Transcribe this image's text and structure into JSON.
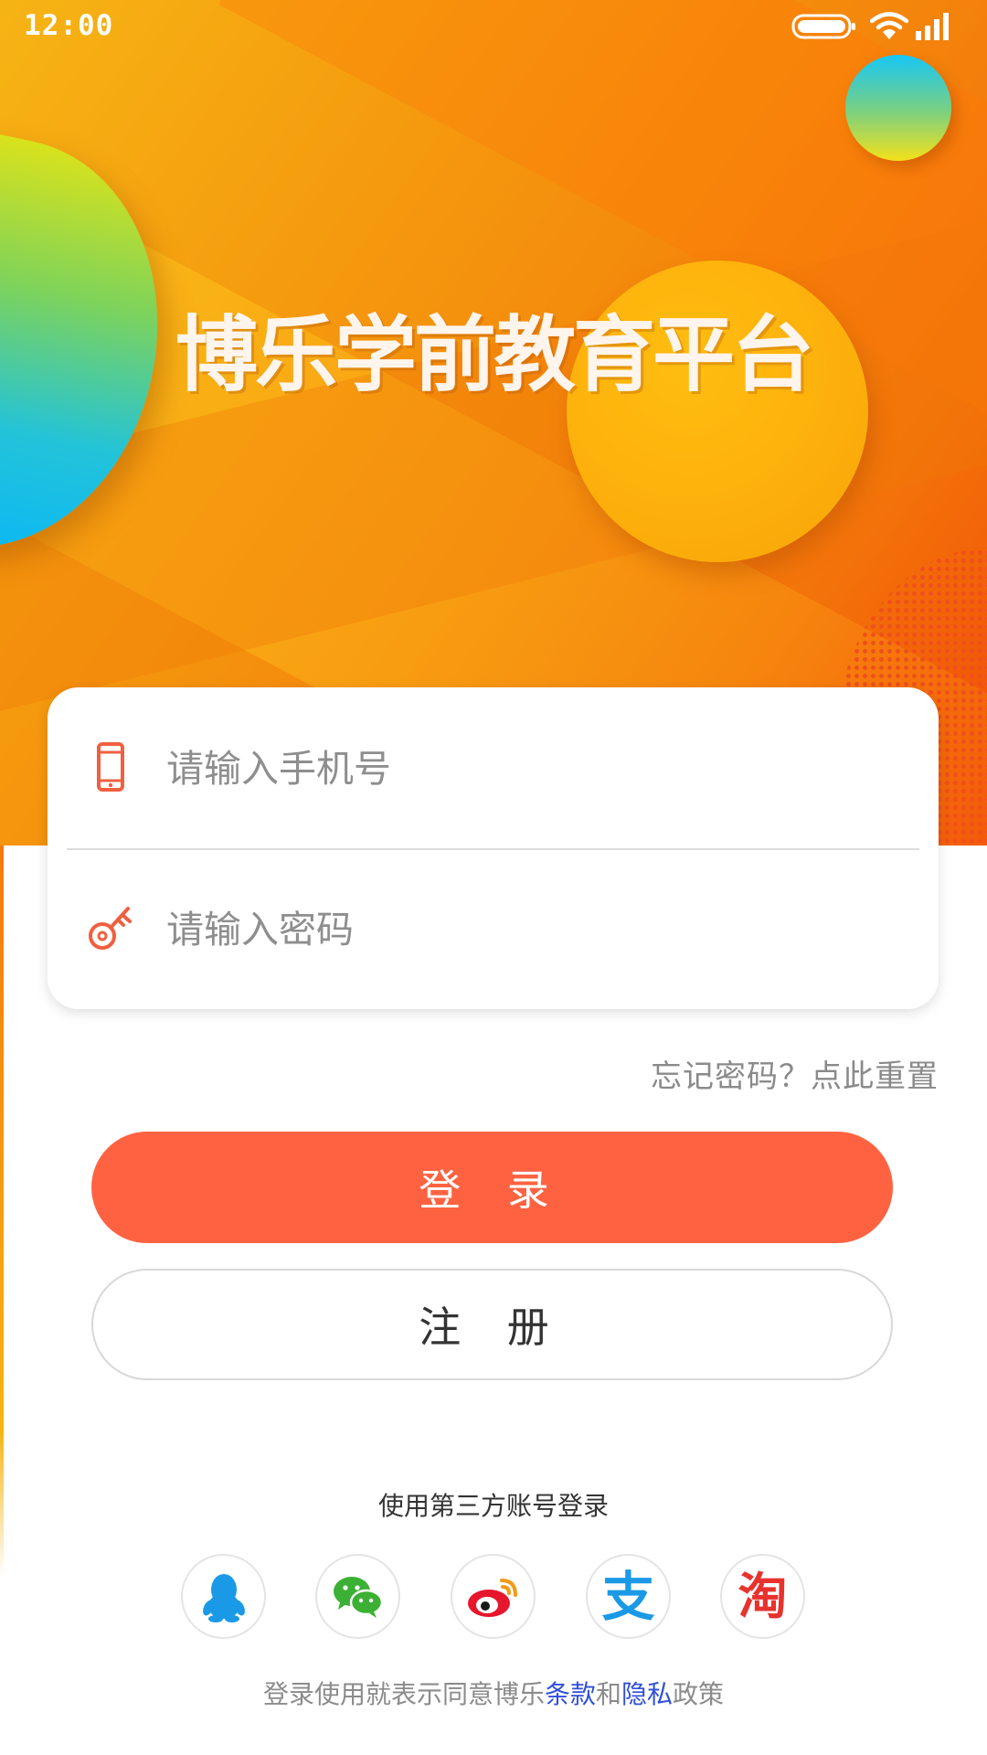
{
  "status_bar": {
    "time": "12:00"
  },
  "hero": {
    "title": "博乐学前教育平台"
  },
  "login_form": {
    "phone_placeholder": "请输入手机号",
    "password_placeholder": "请输入密码"
  },
  "forgot_password": "忘记密码？点此重置",
  "buttons": {
    "login": "登 录",
    "register": "注 册"
  },
  "third_party": {
    "title": "使用第三方账号登录",
    "providers": [
      {
        "name": "qq",
        "icon": "qq-penguin-icon",
        "color": "#1a9ae6"
      },
      {
        "name": "wechat",
        "icon": "wechat-icon",
        "color": "#3cb034"
      },
      {
        "name": "weibo",
        "icon": "weibo-icon",
        "color": "#e6162d"
      },
      {
        "name": "alipay",
        "icon": "alipay-icon",
        "color": "#1a9ae6",
        "glyph": "支"
      },
      {
        "name": "taobao",
        "icon": "taobao-icon",
        "color": "#e8322d",
        "glyph": "淘"
      }
    ]
  },
  "agreement": {
    "prefix": "登录使用就表示同意博乐",
    "terms": "条款",
    "and": "和",
    "privacy": "隐私",
    "suffix": "政策"
  },
  "colors": {
    "primary": "#ff6241",
    "hero_orange": "#f4880c",
    "link_blue": "#2f4fd9",
    "placeholder_gray": "#8e8e8e"
  }
}
